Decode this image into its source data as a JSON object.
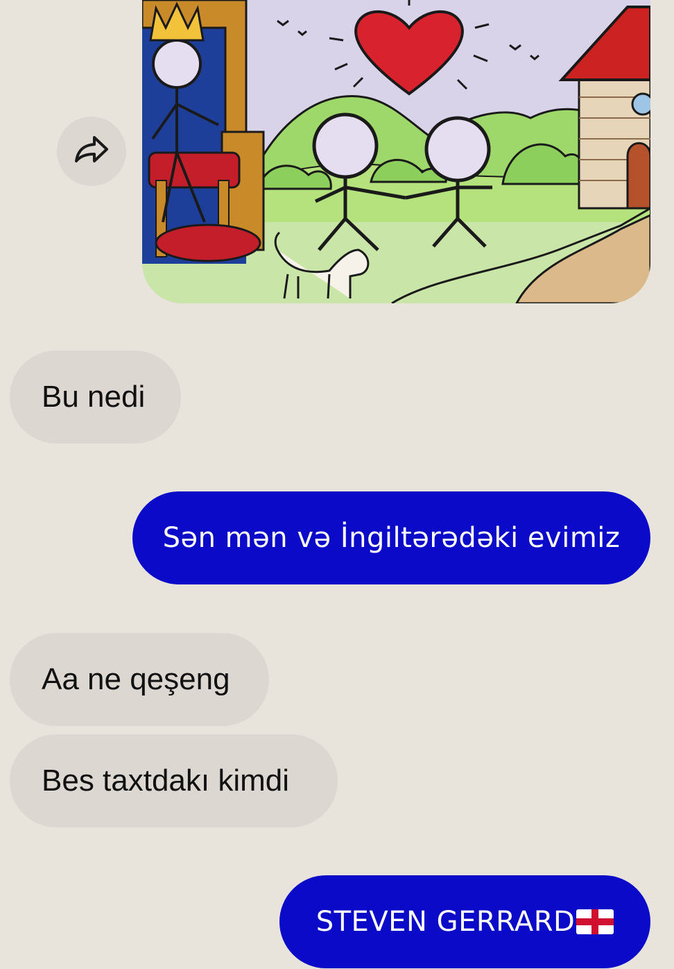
{
  "chat": {
    "messages": [
      {
        "id": "msg1",
        "side": "incoming",
        "text": "Bu nedi"
      },
      {
        "id": "msg2",
        "side": "outgoing",
        "text": "Sən mən və İngiltərədəki evimiz"
      },
      {
        "id": "msg3",
        "side": "incoming",
        "text": "Aa ne qeşeng"
      },
      {
        "id": "msg4",
        "side": "incoming",
        "text": "Bes taxtdakı kimdi"
      },
      {
        "id": "msg5",
        "side": "outgoing",
        "text": "STEVEN GERRARD",
        "emoji": "england-flag"
      }
    ],
    "image_message": {
      "description_icon": "share-forward-icon"
    },
    "colors": {
      "background": "#e8e4dc",
      "incoming_bubble": "#dcd8d1",
      "outgoing_bubble": "#0a0ac8",
      "outgoing_text": "#ffffff"
    }
  }
}
